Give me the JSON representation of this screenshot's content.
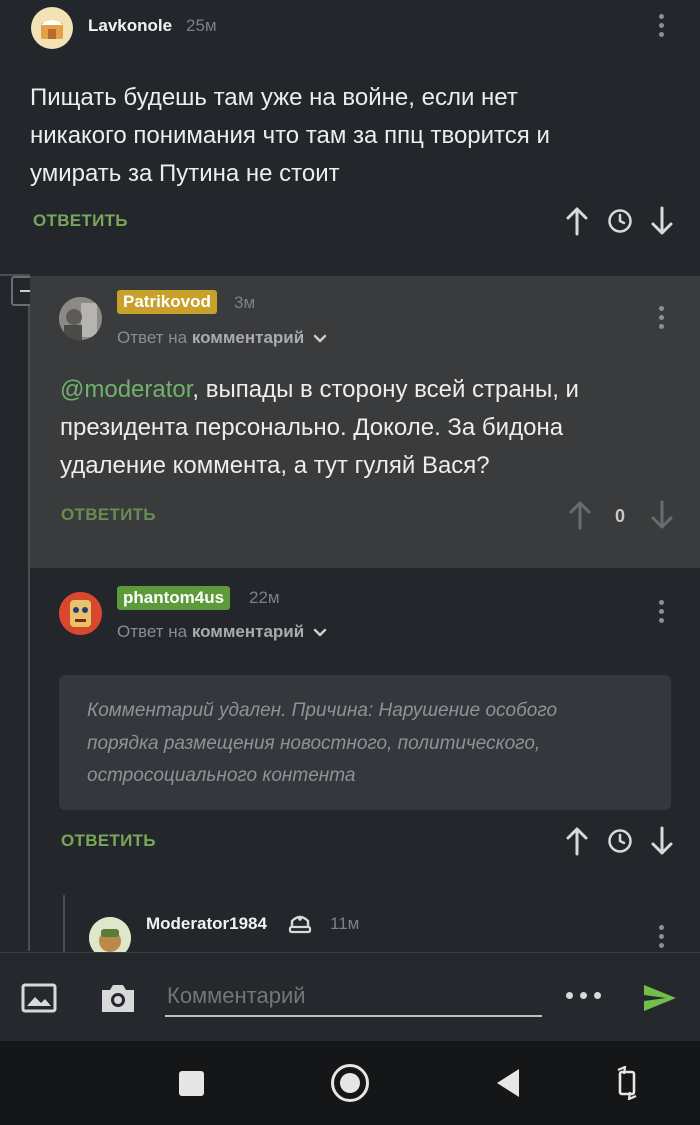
{
  "comments": [
    {
      "username": "Lavkonole",
      "time": "25м",
      "text_lines": [
        "Пищать будешь там уже на войне, если нет",
        "никакого понимания что там за ппц творится и",
        "умирать за Путина не стоит"
      ],
      "reply_label": "ОТВЕТИТЬ"
    },
    {
      "username": "Patrikovod",
      "time": "3м",
      "meta_prefix": "Ответ на",
      "meta_target": "комментарий",
      "mention": "@moderator",
      "text_lines": [
        ", выпады в сторону всей страны, и",
        "президента персонально. Доколе. За бидона",
        "удаление коммента, а тут гуляй Вася?"
      ],
      "reply_label": "ОТВЕТИТЬ",
      "rating": "0",
      "badge_color": "#c8a12a"
    },
    {
      "username": "phantom4us",
      "time": "22м",
      "meta_prefix": "Ответ на",
      "meta_target": "комментарий",
      "deleted_lines": [
        "Комментарий удален. Причина: Нарушение особого",
        "порядка размещения новостного, политического,",
        "остросоциального контента"
      ],
      "reply_label": "ОТВЕТИТЬ",
      "badge_color": "#5d9a3a"
    },
    {
      "username": "Moderator1984",
      "time": "11м"
    }
  ],
  "composer": {
    "placeholder": "Комментарий"
  },
  "colors": {
    "background": "#23262b",
    "highlight": "#3a3b3c",
    "accent_green": "#78a75a",
    "mention_green": "#6fb36a",
    "send_green": "#6fbf4a"
  }
}
